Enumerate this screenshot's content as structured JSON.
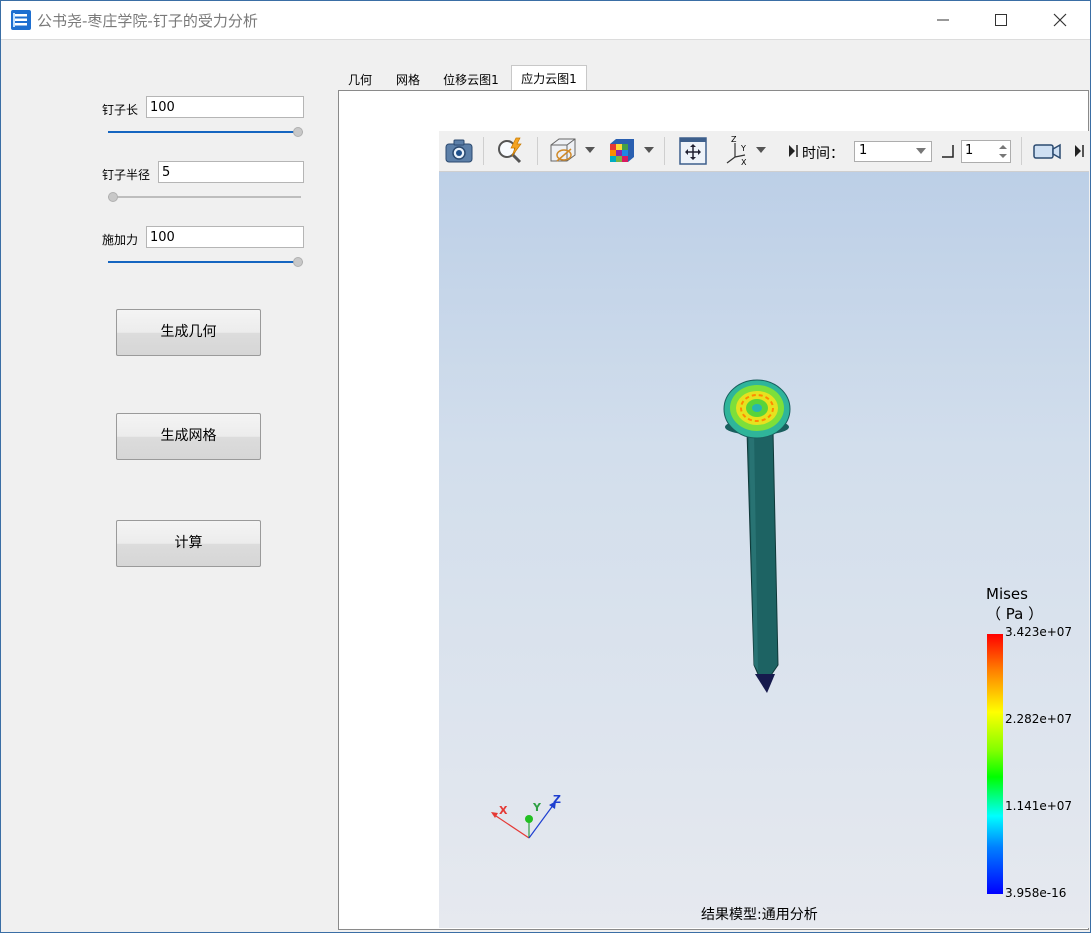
{
  "window": {
    "title": "公书尧-枣庄学院-钉子的受力分析"
  },
  "controls": {
    "nail_length": {
      "label": "钉子长",
      "value": "100",
      "slider_fraction": 1.0
    },
    "nail_radius": {
      "label": "钉子半径",
      "value": "5",
      "slider_fraction": 0.0
    },
    "applied_force": {
      "label": "施加力",
      "value": "100",
      "slider_fraction": 1.0
    }
  },
  "buttons": {
    "generate_geometry": "生成几何",
    "generate_mesh": "生成网格",
    "compute": "计算"
  },
  "tabs": [
    {
      "label": "几何",
      "active": false
    },
    {
      "label": "网格",
      "active": false
    },
    {
      "label": "位移云图1",
      "active": false
    },
    {
      "label": "应力云图1",
      "active": true
    }
  ],
  "toolbar": {
    "icons": [
      "camera-icon",
      "zoom-query-icon",
      "display-mode-icon",
      "color-map-icon",
      "fit-view-icon",
      "axes-icon",
      "record-icon"
    ],
    "time_label": "时间：",
    "time_value": "1",
    "step_value": "1"
  },
  "legend": {
    "title": "Mises",
    "unit": "（ Pa ）",
    "max": "3.423e+07",
    "mid_high": "2.282e+07",
    "mid_low": "1.141e+07",
    "min": "3.958e-16"
  },
  "triad": {
    "x": "X",
    "y": "Y",
    "z": "Z"
  },
  "status": {
    "result_model": "结果模型:通用分析"
  },
  "colors": {
    "accent": "#1565c0",
    "nail_body": "#1d6363"
  }
}
